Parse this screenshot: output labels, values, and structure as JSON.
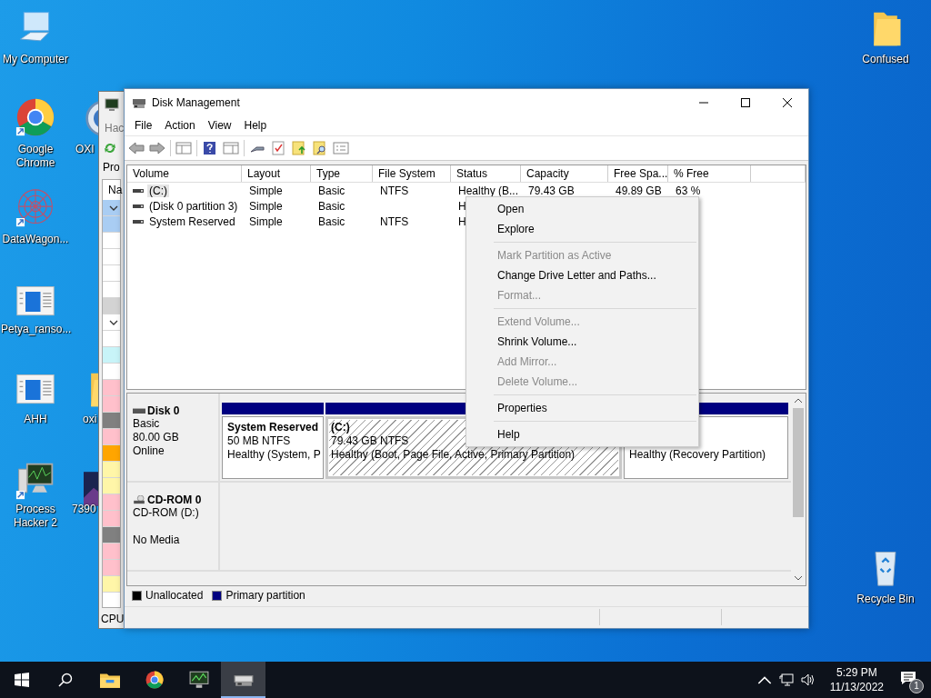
{
  "desktop_icons": [
    {
      "label": "My Computer",
      "kind": "computer"
    },
    {
      "label": "Google Chrome",
      "kind": "chrome"
    },
    {
      "label": "DataWagon...",
      "kind": "pattern"
    },
    {
      "label": "Petya_ranso...",
      "kind": "document"
    },
    {
      "label": "AHH",
      "kind": "document"
    },
    {
      "label": "Process Hacker 2",
      "kind": "monitor"
    },
    {
      "label": "OXI",
      "kind": "globe"
    },
    {
      "label": "oxi",
      "kind": "folder"
    },
    {
      "label": "7390",
      "kind": "thumbnail"
    },
    {
      "label": "Confused",
      "kind": "folder"
    },
    {
      "label": "Recycle Bin",
      "kind": "recycle"
    }
  ],
  "background_window": {
    "menu": "Hac",
    "tab": "Pro",
    "column": "Na",
    "status": "CPU",
    "rows": [
      {
        "color": "#a9cdf3",
        "expanded": true
      },
      {
        "color": "#a9cdf3",
        "expanded": false
      },
      {
        "color": "#ffffff",
        "expanded": false
      },
      {
        "color": "#ffffff",
        "expanded": false
      },
      {
        "color": "#ffffff",
        "expanded": false
      },
      {
        "color": "#ffffff",
        "expanded": false
      },
      {
        "color": "#d3d3d3",
        "expanded": false
      },
      {
        "color": "#ffffff",
        "expanded": true
      },
      {
        "color": "#ffffff",
        "expanded": false
      },
      {
        "color": "#c8f4f8",
        "expanded": false
      },
      {
        "color": "#ffffff",
        "expanded": false
      },
      {
        "color": "#ffc0cb",
        "expanded": false
      },
      {
        "color": "#ffc0cb",
        "expanded": false
      },
      {
        "color": "#808080",
        "expanded": false
      },
      {
        "color": "#ffc0cb",
        "expanded": false
      },
      {
        "color": "#ffa500",
        "expanded": false
      },
      {
        "color": "#fff6a8",
        "expanded": false
      },
      {
        "color": "#fff6a8",
        "expanded": false
      },
      {
        "color": "#ffc0cb",
        "expanded": false
      },
      {
        "color": "#ffc0cb",
        "expanded": false
      },
      {
        "color": "#808080",
        "expanded": false
      },
      {
        "color": "#ffc0cb",
        "expanded": false
      },
      {
        "color": "#ffc0cb",
        "expanded": false
      },
      {
        "color": "#fff6a8",
        "expanded": false
      }
    ]
  },
  "window": {
    "title": "Disk Management",
    "menu": [
      "File",
      "Action",
      "View",
      "Help"
    ],
    "table": {
      "columns": [
        "Volume",
        "Layout",
        "Type",
        "File System",
        "Status",
        "Capacity",
        "Free Spa...",
        "% Free"
      ],
      "rows": [
        {
          "selected": true,
          "cells": [
            "(C:)",
            "Simple",
            "Basic",
            "NTFS",
            "Healthy (B...",
            "79.43 GB",
            "49.89 GB",
            "63 %"
          ]
        },
        {
          "selected": false,
          "cells": [
            "(Disk 0 partition 3)",
            "Simple",
            "Basic",
            null,
            "H"
          ]
        },
        {
          "selected": false,
          "cells": [
            "System Reserved",
            "Simple",
            "Basic",
            "NTFS",
            "H"
          ]
        }
      ]
    },
    "disks": [
      {
        "kind": "disk",
        "name": "Disk 0",
        "type": "Basic",
        "size": "80.00 GB",
        "status": "Online",
        "partitions": [
          {
            "name": "System Reserved",
            "size": "50 MB NTFS",
            "status": "Healthy (System, P",
            "selected": false
          },
          {
            "name": "(C:)",
            "size": "79.43 GB NTFS",
            "status": "Healthy (Boot, Page File, Active, Primary Partition)",
            "selected": true
          },
          {
            "status": "Healthy (Recovery Partition)",
            "selected": false
          }
        ]
      },
      {
        "kind": "cdrom",
        "name": "CD-ROM 0",
        "type": "CD-ROM (D:)",
        "status": "No Media"
      }
    ],
    "legend": [
      {
        "label": "Unallocated",
        "color": "#000000"
      },
      {
        "label": "Primary partition",
        "color": "#000080"
      }
    ]
  },
  "context_menu": [
    {
      "kind": "item",
      "label": "Open",
      "disabled": false
    },
    {
      "kind": "item",
      "label": "Explore",
      "disabled": false
    },
    {
      "kind": "separator"
    },
    {
      "kind": "item",
      "label": "Mark Partition as Active",
      "disabled": true
    },
    {
      "kind": "item",
      "label": "Change Drive Letter and Paths...",
      "disabled": false
    },
    {
      "kind": "item",
      "label": "Format...",
      "disabled": true
    },
    {
      "kind": "separator"
    },
    {
      "kind": "item",
      "label": "Extend Volume...",
      "disabled": true
    },
    {
      "kind": "item",
      "label": "Shrink Volume...",
      "disabled": false
    },
    {
      "kind": "item",
      "label": "Add Mirror...",
      "disabled": true
    },
    {
      "kind": "item",
      "label": "Delete Volume...",
      "disabled": true
    },
    {
      "kind": "separator"
    },
    {
      "kind": "item",
      "label": "Properties",
      "disabled": false
    },
    {
      "kind": "separator"
    },
    {
      "kind": "item",
      "label": "Help",
      "disabled": false
    }
  ],
  "taskbar": {
    "apps": [
      {
        "kind": "explorer",
        "active": false
      },
      {
        "kind": "chrome",
        "active": false
      },
      {
        "kind": "monitor",
        "active": false
      },
      {
        "kind": "disk",
        "active": true
      }
    ],
    "time": "5:29 PM",
    "date": "11/13/2022",
    "notifications": "1"
  }
}
